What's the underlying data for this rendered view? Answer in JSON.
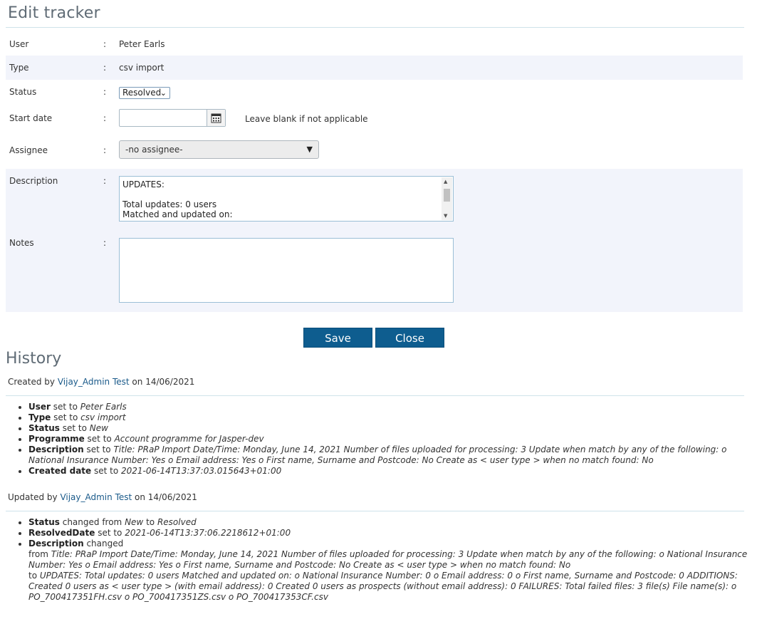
{
  "page_title": "Edit tracker",
  "form": {
    "user": {
      "label": "User",
      "colon": ":",
      "value": "Peter Earls"
    },
    "type": {
      "label": "Type",
      "colon": ":",
      "value": "csv import"
    },
    "status": {
      "label": "Status",
      "colon": ":",
      "value": "Resolved"
    },
    "start_date": {
      "label": "Start date",
      "colon": ":",
      "value": "",
      "hint": "Leave blank if not applicable"
    },
    "assignee": {
      "label": "Assignee",
      "colon": ":",
      "value": "-no assignee-"
    },
    "description": {
      "label": "Description",
      "colon": ":",
      "value": "UPDATES:\n\nTotal updates: 0 users\nMatched and updated on:"
    },
    "notes": {
      "label": "Notes",
      "colon": ":",
      "value": ""
    }
  },
  "buttons": {
    "save": "Save",
    "close": "Close"
  },
  "history": {
    "title": "History",
    "entries": [
      {
        "prefix": "Created by ",
        "user": "Vijay_Admin Test",
        "on": " on ",
        "date": "14/06/2021",
        "items": [
          {
            "field": "User",
            "verb": " set to ",
            "value": "Peter Earls"
          },
          {
            "field": "Type",
            "verb": " set to ",
            "value": "csv import"
          },
          {
            "field": "Status",
            "verb": " set to ",
            "value": "New"
          },
          {
            "field": "Programme",
            "verb": " set to ",
            "value": "Account programme for Jasper-dev"
          },
          {
            "field": "Description",
            "verb": " set to ",
            "value": "Title: PRaP Import Date/Time: Monday, June 14, 2021 Number of files uploaded for processing: 3 Update when match by any of the following: o National Insurance Number: Yes o Email address: Yes o First name, Surname and Postcode: No Create as < user type > when no match found: No"
          },
          {
            "field": "Created date",
            "verb": " set to ",
            "value": "2021-06-14T13:37:03.015643+01:00"
          }
        ]
      },
      {
        "prefix": "Updated by ",
        "user": "Vijay_Admin Test",
        "on": " on ",
        "date": "14/06/2021",
        "items": [
          {
            "field": "Status",
            "verb": " changed from ",
            "value": "New",
            "verb2": " to ",
            "value2": "Resolved"
          },
          {
            "field": "ResolvedDate",
            "verb": " set to ",
            "value": "2021-06-14T13:37:06.2218612+01:00"
          },
          {
            "field": "Description",
            "verb": " changed",
            "from_label": "from ",
            "from_value": "Title: PRaP Import Date/Time: Monday, June 14, 2021 Number of files uploaded for processing: 3 Update when match by any of the following: o National Insurance Number: Yes o Email address: Yes o First name, Surname and Postcode: No Create as < user type > when no match found: No",
            "to_label": "to ",
            "to_value": "UPDATES: Total updates: 0 users Matched and updated on: o National Insurance Number: 0 o Email address: 0 o First name, Surname and Postcode: 0 ADDITIONS: Created 0 users as < user type > (with email address): 0 Created 0 users as prospects (without email address): 0 FAILURES: Total failed files: 3 file(s) File name(s): o PO_700417351FH.csv o PO_700417351ZS.csv o PO_700417353CF.csv"
          }
        ]
      }
    ]
  }
}
